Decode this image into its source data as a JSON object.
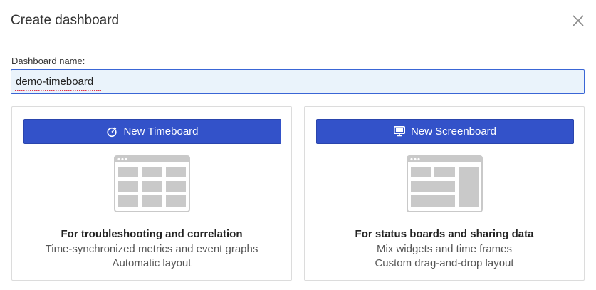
{
  "dialog": {
    "title": "Create dashboard",
    "close_icon": "close-icon"
  },
  "name_field": {
    "label": "Dashboard name:",
    "value": "demo-timeboard"
  },
  "options": [
    {
      "button_label": "New Timeboard",
      "icon": "clock-icon",
      "illustration": "timeboard-grid-illustration",
      "heading": "For troubleshooting and correlation",
      "line1": "Time-synchronized metrics and event graphs",
      "line2": "Automatic layout"
    },
    {
      "button_label": "New Screenboard",
      "icon": "monitor-icon",
      "illustration": "screenboard-layout-illustration",
      "heading": "For status boards and sharing data",
      "line1": "Mix widgets and time frames",
      "line2": "Custom drag-and-drop layout"
    }
  ],
  "colors": {
    "primary_button": "#3352c9",
    "input_focus_border": "#3a66d6",
    "input_background": "#eaf3fb",
    "illustration_gray": "#c9c9c9"
  }
}
